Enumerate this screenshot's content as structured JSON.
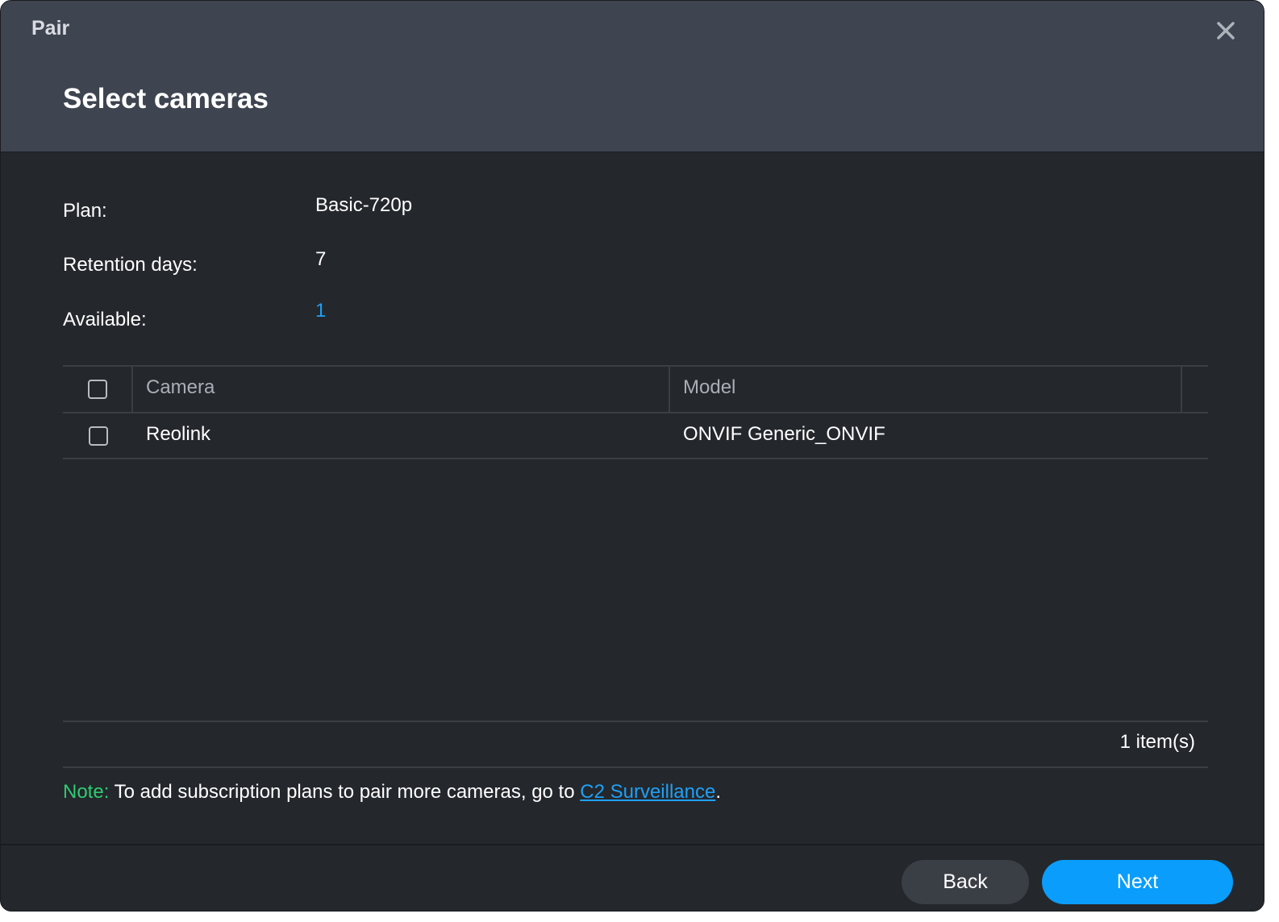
{
  "window": {
    "title": "Pair",
    "close_icon": "close-icon"
  },
  "page": {
    "title": "Select cameras"
  },
  "info": {
    "plan_label": "Plan:",
    "plan_value": "Basic-720p",
    "retention_label": "Retention days:",
    "retention_value": "7",
    "available_label": "Available:",
    "available_value": "1"
  },
  "table": {
    "columns": [
      "Camera",
      "Model"
    ],
    "rows": [
      {
        "camera": "Reolink",
        "model": "ONVIF Generic_ONVIF",
        "checked": false
      }
    ],
    "select_all_checked": false,
    "count_text": "1 item(s)"
  },
  "note": {
    "label": "Note:",
    "text": " To add subscription plans to pair more cameras, go to ",
    "link_text": "C2 Surveillance",
    "suffix": "."
  },
  "footer": {
    "back_label": "Back",
    "next_label": "Next"
  },
  "colors": {
    "header_bg": "#3e4550",
    "body_bg": "#24272c",
    "accent": "#0a9dfb",
    "link": "#1fa0f5",
    "note_label": "#2ecc71"
  }
}
